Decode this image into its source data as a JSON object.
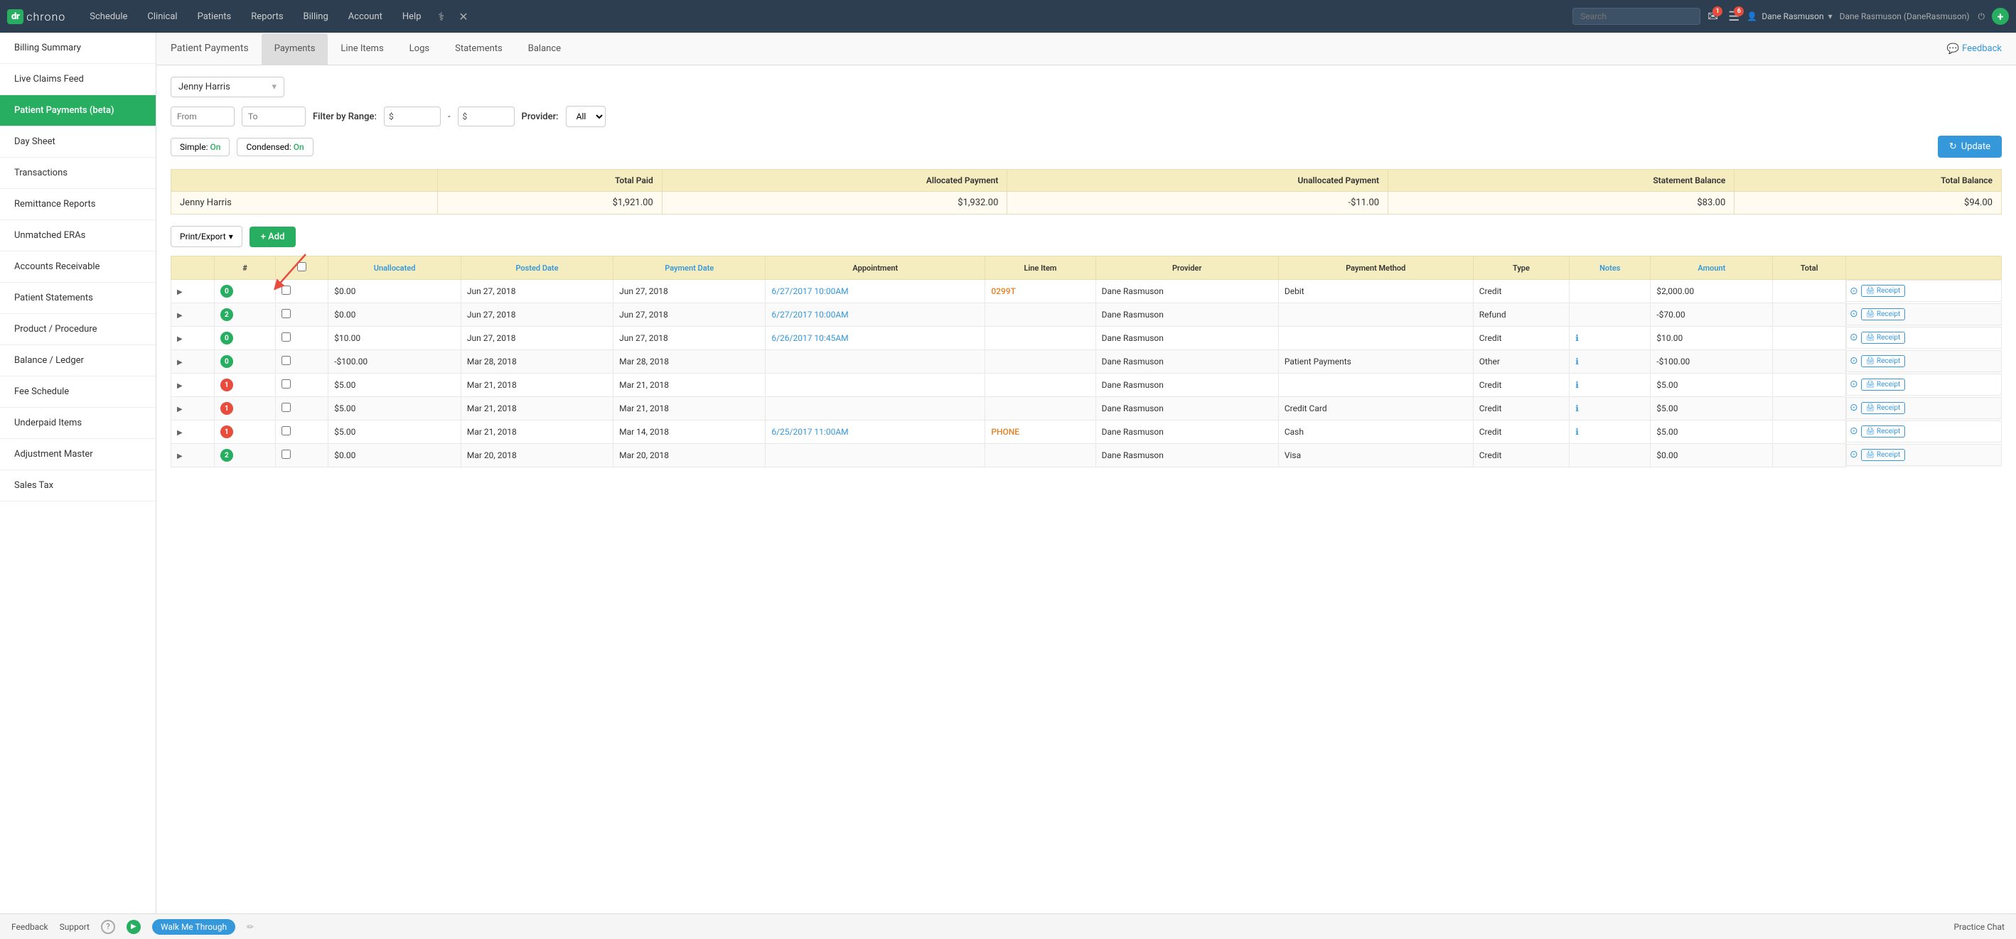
{
  "app": {
    "logo_dr": "dr",
    "logo_chrono": "chrono"
  },
  "nav": {
    "links": [
      "Schedule",
      "Clinical",
      "Patients",
      "Reports",
      "Billing",
      "Account",
      "Help"
    ],
    "search_placeholder": "Search",
    "user_name": "Dane Rasmuson",
    "user_account": "Dane Rasmuson (DaneRasmuson)",
    "mail_badge": "1",
    "menu_badge": "6"
  },
  "sidebar": {
    "items": [
      {
        "label": "Billing Summary",
        "active": false
      },
      {
        "label": "Live Claims Feed",
        "active": false
      },
      {
        "label": "Patient Payments (beta)",
        "active": true
      },
      {
        "label": "Day Sheet",
        "active": false
      },
      {
        "label": "Transactions",
        "active": false
      },
      {
        "label": "Remittance Reports",
        "active": false
      },
      {
        "label": "Unmatched ERAs",
        "active": false
      },
      {
        "label": "Accounts Receivable",
        "active": false
      },
      {
        "label": "Patient Statements",
        "active": false
      },
      {
        "label": "Product / Procedure",
        "active": false
      },
      {
        "label": "Balance / Ledger",
        "active": false
      },
      {
        "label": "Fee Schedule",
        "active": false
      },
      {
        "label": "Underpaid Items",
        "active": false
      },
      {
        "label": "Adjustment Master",
        "active": false
      },
      {
        "label": "Sales Tax",
        "active": false
      }
    ]
  },
  "tabs": {
    "page_title": "Patient Payments",
    "items": [
      "Payments",
      "Line Items",
      "Logs",
      "Statements",
      "Balance"
    ],
    "active": "Payments",
    "feedback_label": "Feedback"
  },
  "filters": {
    "patient_name": "Jenny Harris",
    "from_placeholder": "From",
    "to_placeholder": "To",
    "filter_by_range_label": "Filter by Range:",
    "range_min_placeholder": "$",
    "range_max_placeholder": "$",
    "dash": "-",
    "provider_label": "Provider:",
    "provider_value": "All"
  },
  "toggles": {
    "simple_label": "Simple:",
    "simple_value": "On",
    "condensed_label": "Condensed:",
    "condensed_value": "On",
    "update_label": "Update"
  },
  "summary": {
    "columns": [
      "",
      "Total Paid",
      "Allocated Payment",
      "Unallocated Payment",
      "Statement Balance",
      "Total Balance"
    ],
    "row": {
      "name": "Jenny Harris",
      "total_paid": "$1,921.00",
      "allocated_payment": "$1,932.00",
      "unallocated_payment": "-$11.00",
      "statement_balance": "$83.00",
      "total_balance": "$94.00"
    }
  },
  "actions": {
    "print_export_label": "Print/Export",
    "add_label": "+ Add"
  },
  "table": {
    "columns": [
      "",
      "#",
      "",
      "Unallocated",
      "Posted Date",
      "Payment Date",
      "Appointment",
      "Line Item",
      "Provider",
      "Payment Method",
      "Type",
      "Notes",
      "Amount",
      "Total",
      ""
    ],
    "rows": [
      {
        "badge": "0",
        "badge_color": "green",
        "unallocated": "$0.00",
        "posted_date": "Jun 27, 2018",
        "payment_date": "Jun 27, 2018",
        "appointment": "6/27/2017 10:00AM",
        "line_item": "0299T",
        "provider": "Dane Rasmuson",
        "payment_method": "Debit",
        "type": "Credit",
        "notes": "",
        "amount": "$2,000.00",
        "total": "",
        "has_info": false
      },
      {
        "badge": "2",
        "badge_color": "green",
        "unallocated": "$0.00",
        "posted_date": "Jun 27, 2018",
        "payment_date": "Jun 27, 2018",
        "appointment": "6/27/2017 10:00AM",
        "line_item": "",
        "provider": "Dane Rasmuson",
        "payment_method": "",
        "type": "Refund",
        "notes": "",
        "amount": "-$70.00",
        "total": "",
        "has_info": false
      },
      {
        "badge": "0",
        "badge_color": "green",
        "unallocated": "$10.00",
        "posted_date": "Jun 27, 2018",
        "payment_date": "Jun 27, 2018",
        "appointment": "6/26/2017 10:45AM",
        "line_item": "",
        "provider": "Dane Rasmuson",
        "payment_method": "",
        "type": "Credit",
        "notes": "ℹ",
        "amount": "$10.00",
        "total": "",
        "has_info": true
      },
      {
        "badge": "0",
        "badge_color": "green",
        "unallocated": "-$100.00",
        "posted_date": "Mar 28, 2018",
        "payment_date": "Mar 28, 2018",
        "appointment": "",
        "line_item": "",
        "provider": "Dane Rasmuson",
        "payment_method": "Patient Payments",
        "type": "Other",
        "notes": "ℹ",
        "amount": "-$100.00",
        "total": "",
        "has_info": true
      },
      {
        "badge": "1",
        "badge_color": "red",
        "unallocated": "$5.00",
        "posted_date": "Mar 21, 2018",
        "payment_date": "Mar 21, 2018",
        "appointment": "",
        "line_item": "",
        "provider": "Dane Rasmuson",
        "payment_method": "",
        "type": "Credit",
        "notes": "ℹ",
        "amount": "$5.00",
        "total": "",
        "has_info": true
      },
      {
        "badge": "1",
        "badge_color": "red",
        "unallocated": "$5.00",
        "posted_date": "Mar 21, 2018",
        "payment_date": "Mar 21, 2018",
        "appointment": "",
        "line_item": "",
        "provider": "Dane Rasmuson",
        "payment_method": "Credit Card",
        "type": "Credit",
        "notes": "ℹ",
        "amount": "$5.00",
        "total": "",
        "has_info": true
      },
      {
        "badge": "1",
        "badge_color": "red",
        "unallocated": "$5.00",
        "posted_date": "Mar 21, 2018",
        "payment_date": "Mar 14, 2018",
        "appointment": "6/25/2017 11:00AM",
        "line_item": "PHONE",
        "provider": "Dane Rasmuson",
        "payment_method": "Cash",
        "type": "Credit",
        "notes": "ℹ",
        "amount": "$5.00",
        "total": "",
        "has_info": true
      },
      {
        "badge": "2",
        "badge_color": "green",
        "unallocated": "$0.00",
        "posted_date": "Mar 20, 2018",
        "payment_date": "Mar 20, 2018",
        "appointment": "",
        "line_item": "",
        "provider": "Dane Rasmuson",
        "payment_method": "Visa",
        "type": "Credit",
        "notes": "",
        "amount": "$0.00",
        "total": "",
        "has_info": false
      }
    ]
  },
  "bottom_bar": {
    "feedback": "Feedback",
    "support": "Support",
    "walk_me_through": "Walk Me Through",
    "practice_chat": "Practice Chat"
  }
}
